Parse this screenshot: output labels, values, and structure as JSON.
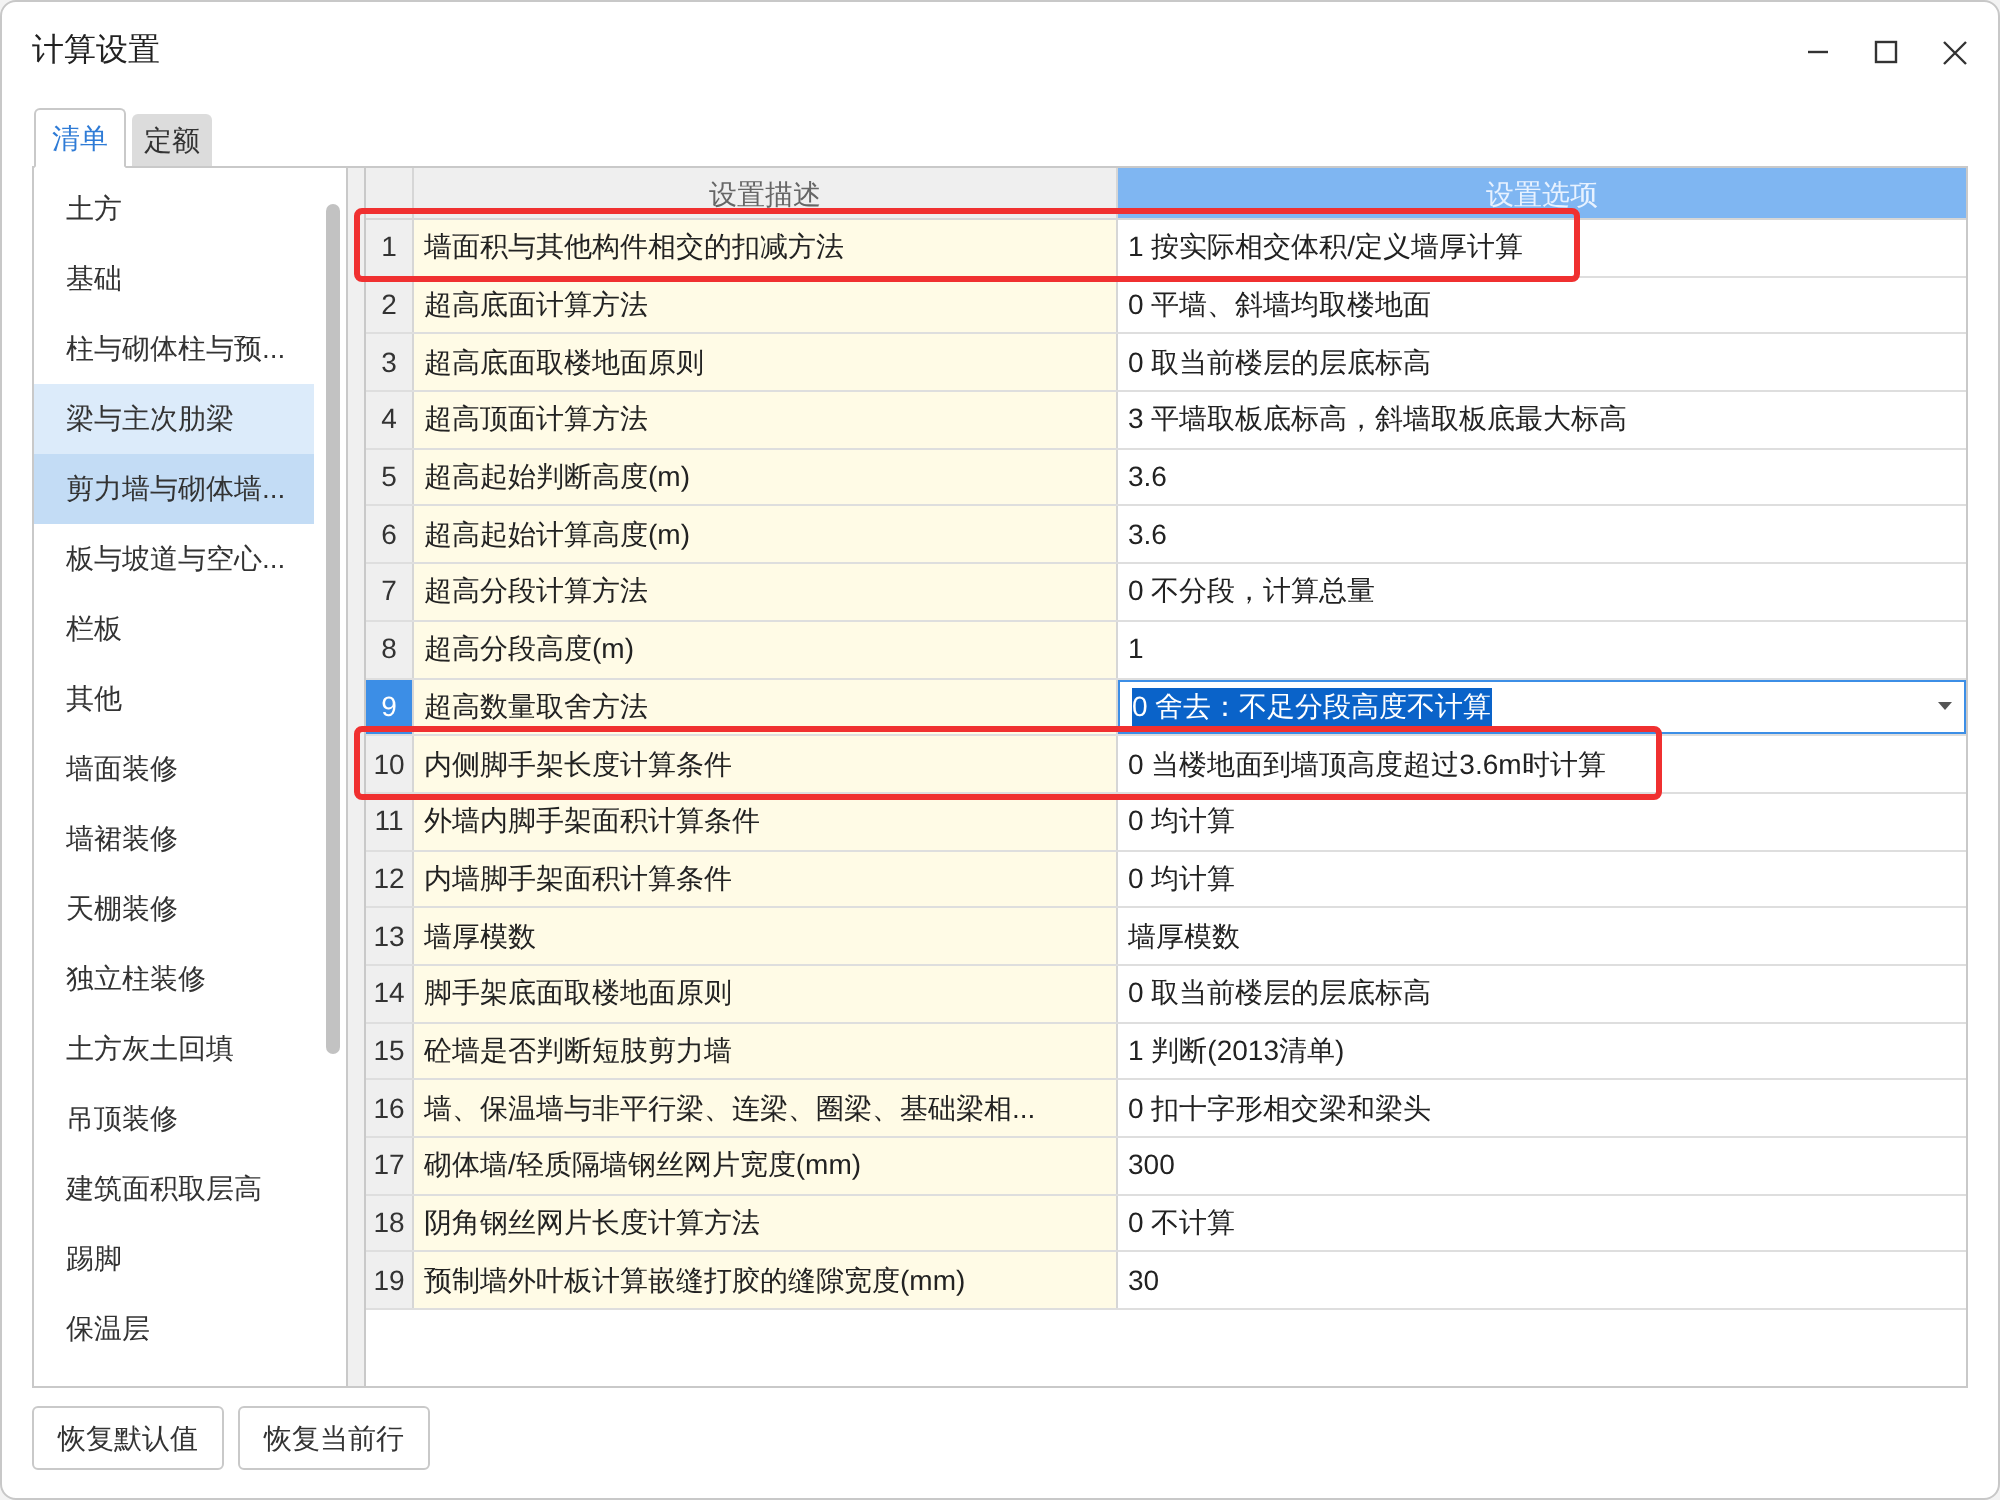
{
  "window": {
    "title": "计算设置"
  },
  "tabs": [
    {
      "label": "清单",
      "selected": true
    },
    {
      "label": "定额",
      "selected": false
    }
  ],
  "sidebar": {
    "items": [
      {
        "label": "土方",
        "selected": false,
        "hovered": false
      },
      {
        "label": "基础",
        "selected": false,
        "hovered": false
      },
      {
        "label": "柱与砌体柱与预...",
        "selected": false,
        "hovered": false
      },
      {
        "label": "梁与主次肋梁",
        "selected": false,
        "hovered": true
      },
      {
        "label": "剪力墙与砌体墙...",
        "selected": true,
        "hovered": false
      },
      {
        "label": "板与坡道与空心...",
        "selected": false,
        "hovered": false
      },
      {
        "label": "栏板",
        "selected": false,
        "hovered": false
      },
      {
        "label": "其他",
        "selected": false,
        "hovered": false
      },
      {
        "label": "墙面装修",
        "selected": false,
        "hovered": false
      },
      {
        "label": "墙裙装修",
        "selected": false,
        "hovered": false
      },
      {
        "label": "天棚装修",
        "selected": false,
        "hovered": false
      },
      {
        "label": "独立柱装修",
        "selected": false,
        "hovered": false
      },
      {
        "label": "土方灰土回填",
        "selected": false,
        "hovered": false
      },
      {
        "label": "吊顶装修",
        "selected": false,
        "hovered": false
      },
      {
        "label": "建筑面积取层高",
        "selected": false,
        "hovered": false
      },
      {
        "label": "踢脚",
        "selected": false,
        "hovered": false
      },
      {
        "label": "保温层",
        "selected": false,
        "hovered": false
      }
    ]
  },
  "table": {
    "columns": [
      "设置描述",
      "设置选项"
    ],
    "rows": [
      {
        "no": "1",
        "description": "墙面积与其他构件相交的扣减方法",
        "value": "1 按实际相交体积/定义墙厚计算",
        "selected": false,
        "circled": true
      },
      {
        "no": "2",
        "description": "超高底面计算方法",
        "value": "0 平墙、斜墙均取楼地面",
        "selected": false,
        "circled": false
      },
      {
        "no": "3",
        "description": "超高底面取楼地面原则",
        "value": "0 取当前楼层的层底标高",
        "selected": false,
        "circled": false
      },
      {
        "no": "4",
        "description": "超高顶面计算方法",
        "value": "3 平墙取板底标高，斜墙取板底最大标高",
        "selected": false,
        "circled": false
      },
      {
        "no": "5",
        "description": "超高起始判断高度(m)",
        "value": "3.6",
        "selected": false,
        "circled": false
      },
      {
        "no": "6",
        "description": "超高起始计算高度(m)",
        "value": "3.6",
        "selected": false,
        "circled": false
      },
      {
        "no": "7",
        "description": "超高分段计算方法",
        "value": "0 不分段，计算总量",
        "selected": false,
        "circled": false
      },
      {
        "no": "8",
        "description": "超高分段高度(m)",
        "value": "1",
        "selected": false,
        "circled": false
      },
      {
        "no": "9",
        "description": "超高数量取舍方法",
        "value": "0 舍去：不足分段高度不计算",
        "selected": true,
        "circled": false
      },
      {
        "no": "10",
        "description": "内侧脚手架长度计算条件",
        "value": "0 当楼地面到墙顶高度超过3.6m时计算",
        "selected": false,
        "circled": true
      },
      {
        "no": "11",
        "description": "外墙内脚手架面积计算条件",
        "value": "0 均计算",
        "selected": false,
        "circled": false
      },
      {
        "no": "12",
        "description": "内墙脚手架面积计算条件",
        "value": "0 均计算",
        "selected": false,
        "circled": false
      },
      {
        "no": "13",
        "description": "墙厚模数",
        "value": "墙厚模数",
        "selected": false,
        "circled": false
      },
      {
        "no": "14",
        "description": "脚手架底面取楼地面原则",
        "value": "0 取当前楼层的层底标高",
        "selected": false,
        "circled": false
      },
      {
        "no": "15",
        "description": "砼墙是否判断短肢剪力墙",
        "value": "1 判断(2013清单)",
        "selected": false,
        "circled": false
      },
      {
        "no": "16",
        "description": "墙、保温墙与非平行梁、连梁、圈梁、基础梁相...",
        "value": "0 扣十字形相交梁和梁头",
        "selected": false,
        "circled": false
      },
      {
        "no": "17",
        "description": "砌体墙/轻质隔墙钢丝网片宽度(mm)",
        "value": "300",
        "selected": false,
        "circled": false
      },
      {
        "no": "18",
        "description": "阴角钢丝网片长度计算方法",
        "value": "0 不计算",
        "selected": false,
        "circled": false
      },
      {
        "no": "19",
        "description": "预制墙外叶板计算嵌缝打胶的缝隙宽度(mm)",
        "value": "30",
        "selected": false,
        "circled": false
      }
    ]
  },
  "buttons": [
    "恢复默认值",
    "恢复当前行"
  ]
}
